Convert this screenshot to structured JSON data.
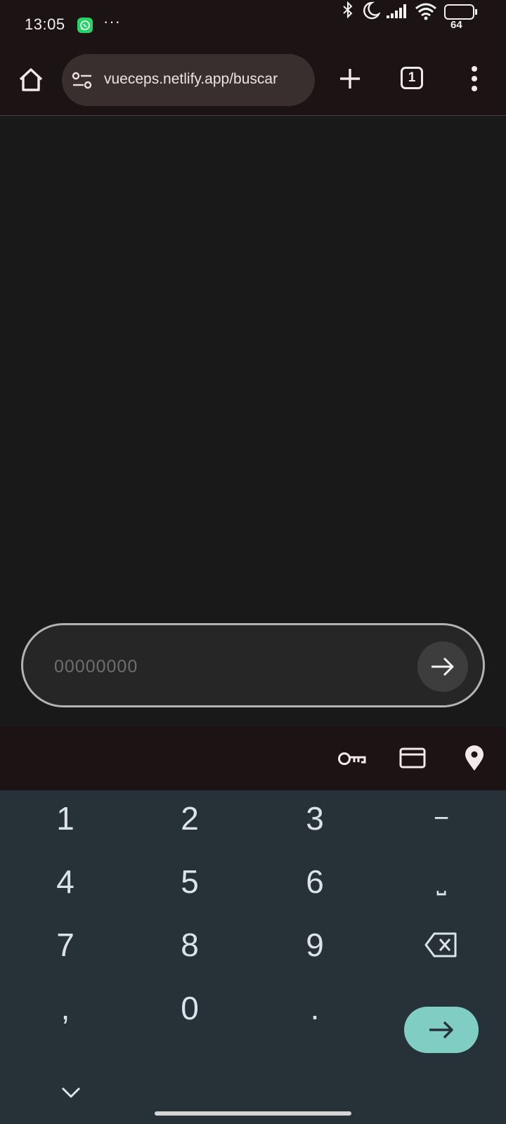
{
  "status_bar": {
    "time": "13:05",
    "overflow_dots": "···",
    "battery_level": "64",
    "icons": [
      "whatsapp-icon",
      "bluetooth-icon",
      "do-not-disturb-moon-icon",
      "signal-icon",
      "wifi-icon",
      "battery-icon"
    ]
  },
  "browser": {
    "url": "vueceps.netlify.app/buscar",
    "tab_count": "1",
    "icons": [
      "home-icon",
      "site-settings-icon",
      "new-tab-icon",
      "tab-switcher-icon",
      "more-menu-icon"
    ]
  },
  "cep_form": {
    "placeholder": "00000000",
    "value": "",
    "submit_icon": "arrow-right-icon"
  },
  "autofill_bar": {
    "icons": [
      "key-icon",
      "credit-card-icon",
      "location-pin-icon"
    ]
  },
  "keyboard": {
    "rows": [
      [
        "1",
        "2",
        "3",
        "−"
      ],
      [
        "4",
        "5",
        "6",
        "⎵"
      ],
      [
        "7",
        "8",
        "9",
        "backspace"
      ],
      [
        ",",
        "0",
        ".",
        "enter"
      ]
    ],
    "accent_color": "#80cdc4",
    "background_color": "#263138"
  }
}
